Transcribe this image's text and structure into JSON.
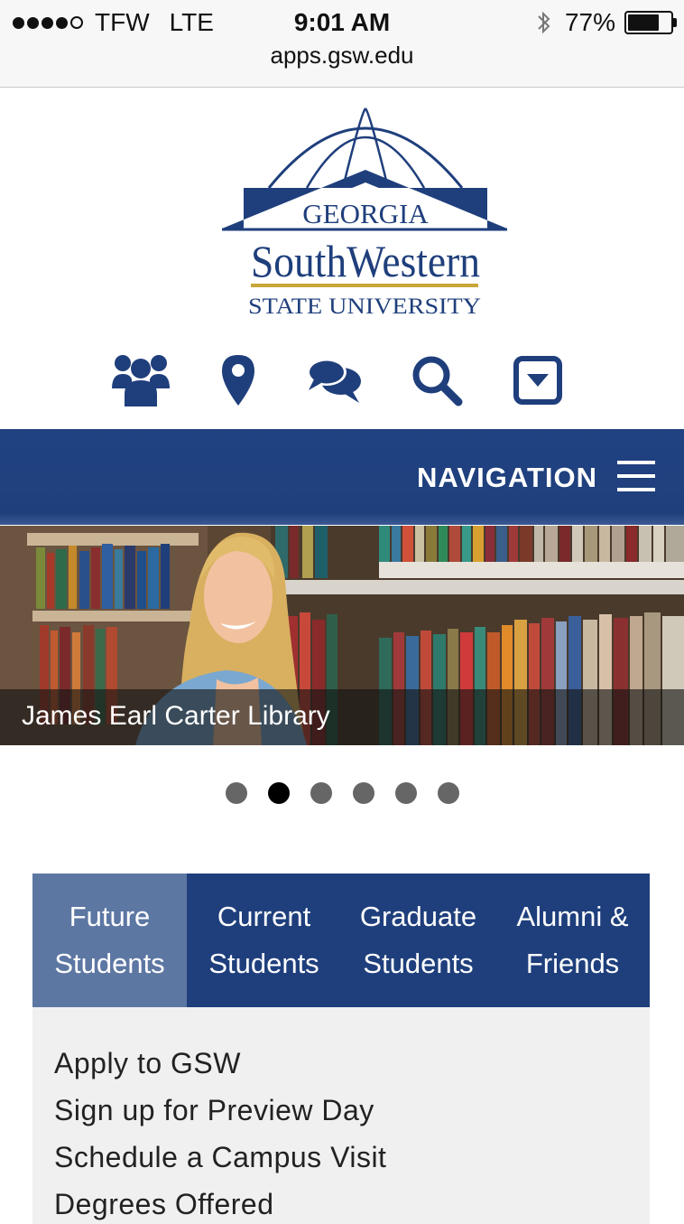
{
  "status_bar": {
    "carrier": "TFW",
    "network": "LTE",
    "time": "9:01 AM",
    "battery_percent": "77%",
    "battery_level": 0.77,
    "url": "apps.gsw.edu"
  },
  "logo": {
    "line1": "GEORGIA",
    "line2": "SouthWestern",
    "line3": "STATE UNIVERSITY",
    "brand_blue": "#1f3f7c",
    "brand_gold": "#c9a63a"
  },
  "quick_icons": [
    "people-icon",
    "map-pin-icon",
    "chat-icon",
    "search-icon",
    "dropdown-box-icon"
  ],
  "navigation": {
    "label": "NAVIGATION"
  },
  "hero": {
    "caption": "James Earl Carter Library"
  },
  "carousel": {
    "total_slides": 6,
    "active_slide": 2
  },
  "tabs": [
    {
      "line1": "Future",
      "line2": "Students",
      "active": true
    },
    {
      "line1": "Current",
      "line2": "Students",
      "active": false
    },
    {
      "line1": "Graduate",
      "line2": "Students",
      "active": false
    },
    {
      "line1": "Alumni &",
      "line2": "Friends",
      "active": false
    }
  ],
  "links": [
    "Apply to GSW",
    "Sign up for Preview Day",
    "Schedule a Campus Visit",
    "Degrees Offered"
  ],
  "colors": {
    "nav_blue": "#1f3f7c",
    "tab_active": "#5d77a3",
    "panel_bg": "#f0f0f0"
  }
}
